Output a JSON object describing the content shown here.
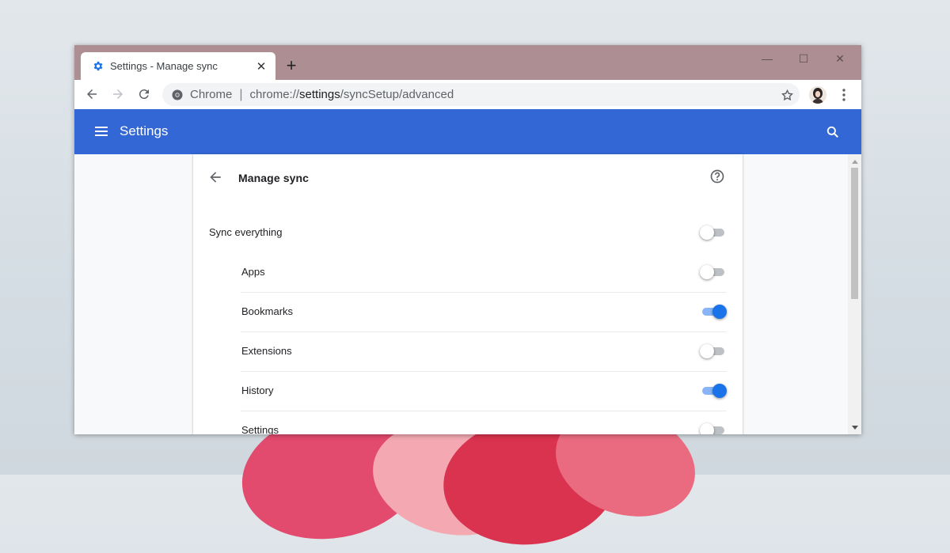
{
  "tab": {
    "title": "Settings - Manage sync",
    "icon": "gear-icon",
    "close": "✕"
  },
  "new_tab": "+",
  "window_controls": {
    "minimize": "—",
    "maximize": "☐",
    "close": "✕"
  },
  "omnibox": {
    "scheme_label": "Chrome",
    "separator": "|",
    "url_prefix": "chrome://",
    "url_host": "settings",
    "url_path": "/syncSetup/advanced"
  },
  "header": {
    "title": "Settings"
  },
  "page": {
    "title": "Manage sync"
  },
  "sync_rows": [
    {
      "label": "Sync everything",
      "enabled": false,
      "indent": false
    },
    {
      "label": "Apps",
      "enabled": false,
      "indent": true
    },
    {
      "label": "Bookmarks",
      "enabled": true,
      "indent": true
    },
    {
      "label": "Extensions",
      "enabled": false,
      "indent": true
    },
    {
      "label": "History",
      "enabled": true,
      "indent": true
    },
    {
      "label": "Settings",
      "enabled": false,
      "indent": true
    }
  ],
  "colors": {
    "header_blue": "#3367d6",
    "titlebar": "#ad8f93",
    "toggle_on": "#1a73e8"
  }
}
